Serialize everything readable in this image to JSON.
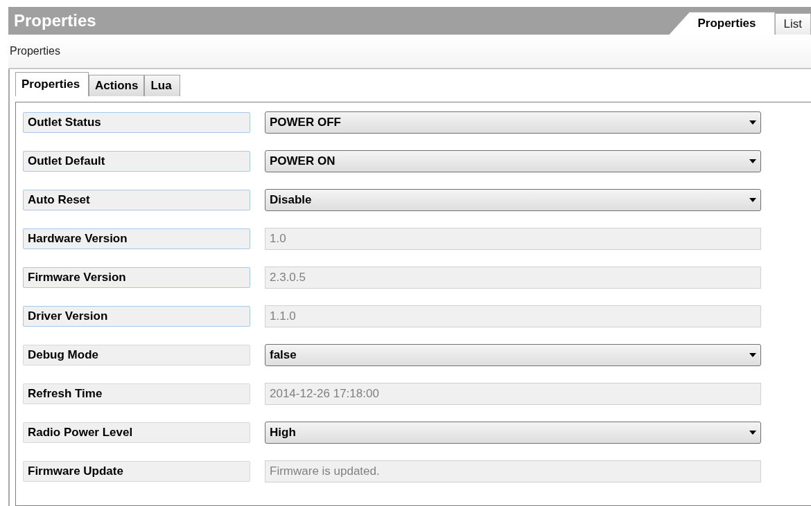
{
  "header": {
    "title": "Properties",
    "tabs": [
      {
        "label": "Properties",
        "selected": true
      },
      {
        "label": "List",
        "selected": false
      }
    ]
  },
  "subheader": {
    "title": "Properties"
  },
  "tabs": [
    {
      "label": "Properties",
      "selected": true
    },
    {
      "label": "Actions",
      "selected": false
    },
    {
      "label": "Lua",
      "selected": false
    }
  ],
  "properties": [
    {
      "label": "Outlet Status",
      "highlighted": true,
      "kind": "dropdown",
      "value": "POWER OFF"
    },
    {
      "label": "Outlet Default",
      "highlighted": true,
      "kind": "dropdown",
      "value": "POWER ON"
    },
    {
      "label": "Auto Reset",
      "highlighted": true,
      "kind": "dropdown",
      "value": "Disable"
    },
    {
      "label": "Hardware Version",
      "highlighted": true,
      "kind": "readonly",
      "value": "1.0"
    },
    {
      "label": "Firmware Version",
      "highlighted": true,
      "kind": "readonly",
      "value": "2.3.0.5"
    },
    {
      "label": "Driver Version",
      "highlighted": true,
      "kind": "readonly",
      "value": "1.1.0"
    },
    {
      "label": "Debug Mode",
      "highlighted": false,
      "kind": "dropdown",
      "value": "false"
    },
    {
      "label": "Refresh Time",
      "highlighted": false,
      "kind": "readonly",
      "value": "2014-12-26 17:18:00"
    },
    {
      "label": "Radio Power Level",
      "highlighted": false,
      "kind": "dropdown",
      "value": "High"
    },
    {
      "label": "Firmware Update",
      "highlighted": false,
      "kind": "readonly",
      "value": "Firmware is updated."
    }
  ]
}
